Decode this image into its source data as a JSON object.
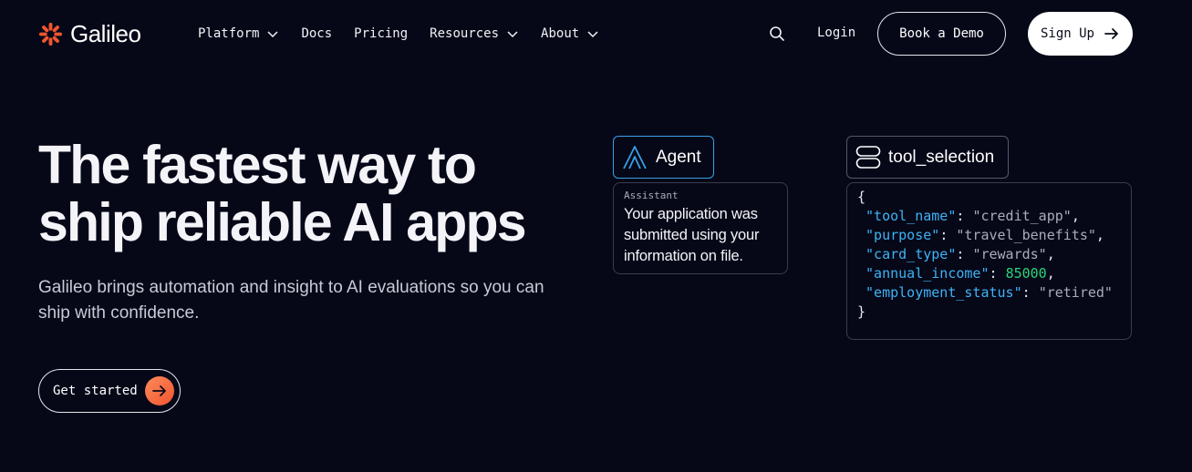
{
  "header": {
    "logo_text": "Galileo",
    "nav": [
      {
        "label": "Platform",
        "has_dropdown": true
      },
      {
        "label": "Docs",
        "has_dropdown": false
      },
      {
        "label": "Pricing",
        "has_dropdown": false
      },
      {
        "label": "Resources",
        "has_dropdown": true
      },
      {
        "label": "About",
        "has_dropdown": true
      }
    ],
    "search_icon": "search-icon",
    "login_label": "Login",
    "demo_label": "Book a Demo",
    "signup_label": "Sign Up"
  },
  "hero": {
    "title_line1": "The fastest way to",
    "title_line2": "ship reliable AI apps",
    "subtitle": "Galileo brings automation and insight to AI evaluations so you can ship with confidence.",
    "cta_label": "Get started"
  },
  "agent_card": {
    "label": "Agent",
    "role": "Assistant",
    "message": "Your application was submitted using your information on file."
  },
  "tool_card": {
    "label": "tool_selection",
    "open_brace": "{",
    "close_brace": "}",
    "fields": [
      {
        "key": "\"tool_name\"",
        "value": "\"credit_app\"",
        "type": "string",
        "trailing": ","
      },
      {
        "key": "\"purpose\"",
        "value": "\"travel_benefits\"",
        "type": "string",
        "trailing": ","
      },
      {
        "key": "\"card_type\"",
        "value": "\"rewards\"",
        "type": "string",
        "trailing": ","
      },
      {
        "key": "\"annual_income\"",
        "value": "85000",
        "type": "number",
        "trailing": ","
      },
      {
        "key": "\"employment_status\"",
        "value": "\"retired\"",
        "type": "string",
        "trailing": ""
      }
    ]
  },
  "colors": {
    "background": "#060818",
    "accent_orange": "#f0552f",
    "agent_border": "#3aa0e6",
    "json_key": "#3fb3f5",
    "json_number": "#2ed47a"
  }
}
